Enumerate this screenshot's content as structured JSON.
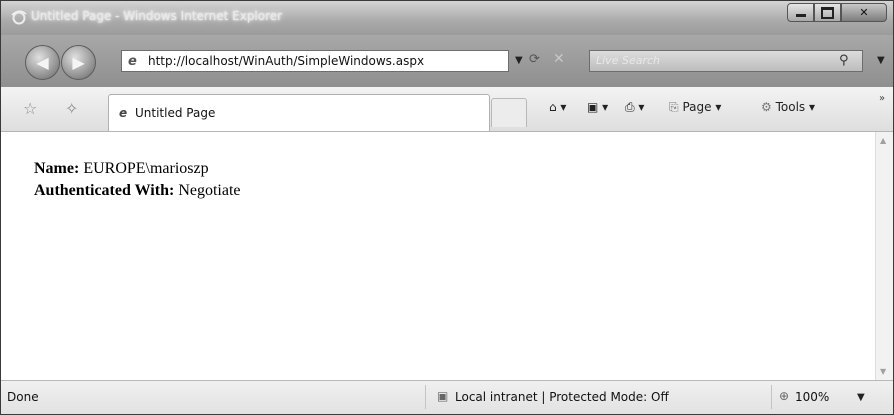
{
  "window": {
    "title": "Untitled Page - Windows Internet Explorer"
  },
  "nav": {
    "back_glyph": "◀",
    "forward_glyph": "▶",
    "address": "http://localhost/WinAuth/SimpleWindows.aspx",
    "search_placeholder": "Live Search"
  },
  "tab": {
    "label": "Untitled Page"
  },
  "commands": {
    "page_label": "Page",
    "tools_label": "Tools"
  },
  "content": {
    "name_label": "Name:",
    "name_value": "EUROPE\\marioszp",
    "auth_label": "Authenticated With:",
    "auth_value": "Negotiate"
  },
  "status": {
    "text": "Done",
    "zone": "Local intranet | Protected Mode: Off",
    "zoom": "100%"
  }
}
